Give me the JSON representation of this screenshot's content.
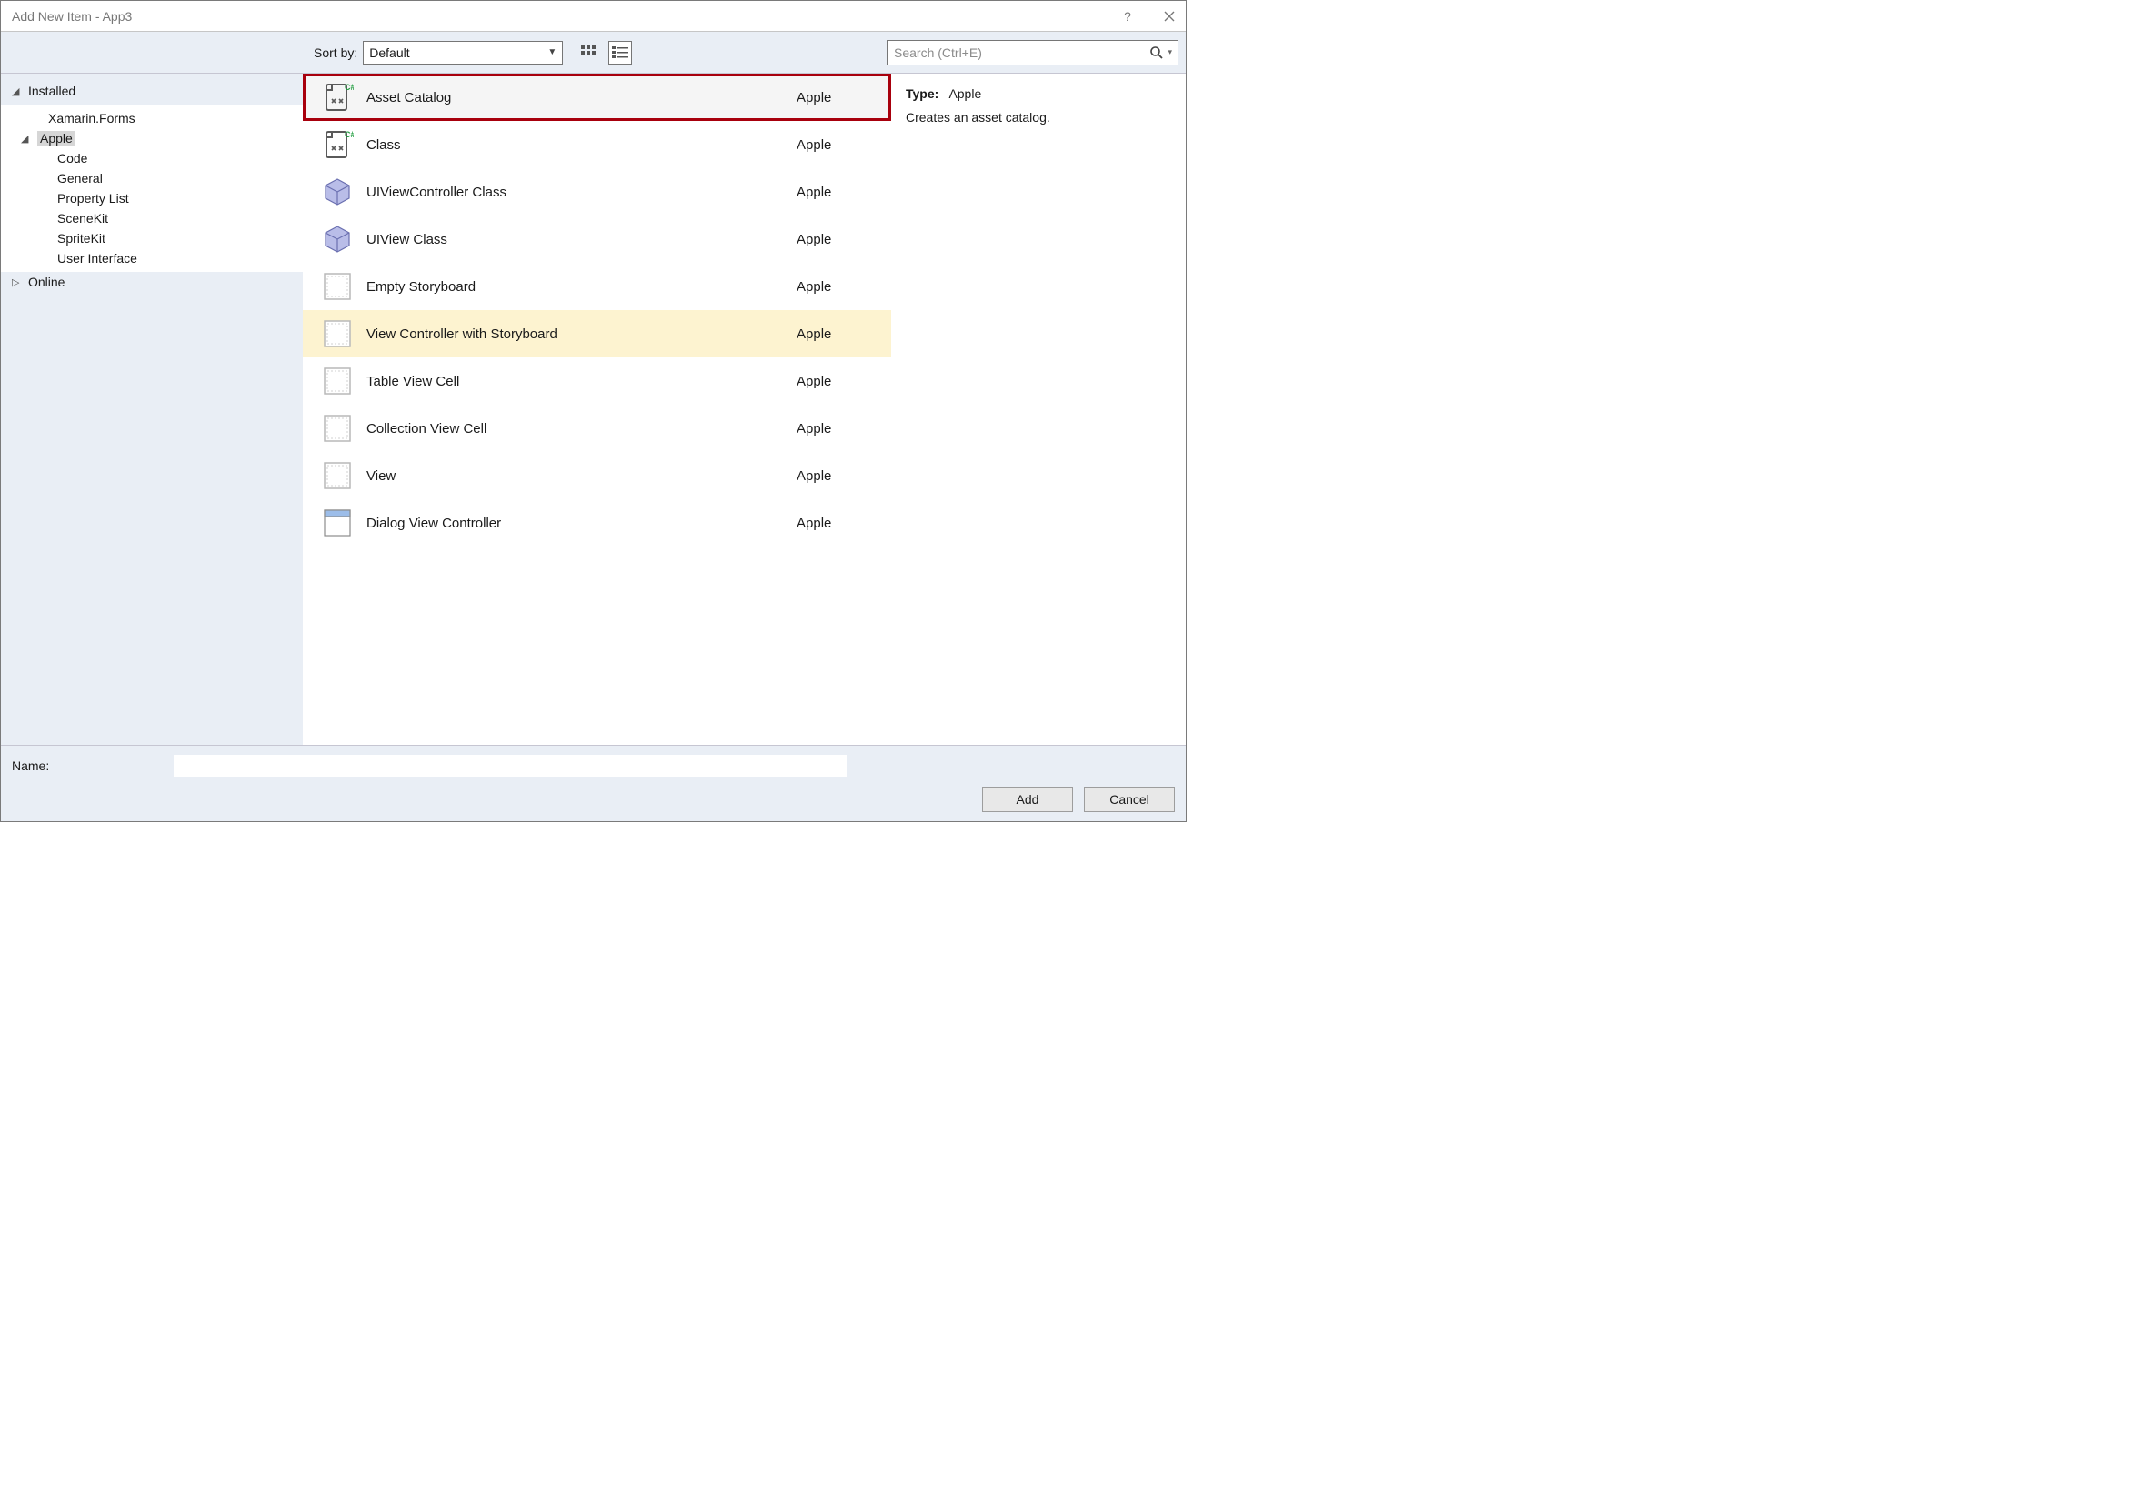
{
  "window": {
    "title": "Add New Item - App3",
    "help_tooltip": "?",
    "close_tooltip": "Close"
  },
  "toolbar": {
    "sort_label": "Sort by:",
    "sort_value": "Default",
    "search_placeholder": "Search (Ctrl+E)"
  },
  "sidebar": {
    "installed_label": "Installed",
    "online_label": "Online",
    "items": [
      {
        "label": "Xamarin.Forms"
      },
      {
        "label": "Apple",
        "selected": true,
        "children": [
          {
            "label": "Code"
          },
          {
            "label": "General"
          },
          {
            "label": "Property List"
          },
          {
            "label": "SceneKit"
          },
          {
            "label": "SpriteKit"
          },
          {
            "label": "User Interface"
          }
        ]
      }
    ]
  },
  "templates": [
    {
      "name": "Asset Catalog",
      "category": "Apple",
      "icon": "csharp",
      "state": "selected"
    },
    {
      "name": "Class",
      "category": "Apple",
      "icon": "csharp"
    },
    {
      "name": "UIViewController Class",
      "category": "Apple",
      "icon": "box3d"
    },
    {
      "name": "UIView Class",
      "category": "Apple",
      "icon": "box3d"
    },
    {
      "name": "Empty Storyboard",
      "category": "Apple",
      "icon": "storyboard"
    },
    {
      "name": "View Controller with Storyboard",
      "category": "Apple",
      "icon": "storyboard",
      "state": "hover"
    },
    {
      "name": "Table View Cell",
      "category": "Apple",
      "icon": "storyboard"
    },
    {
      "name": "Collection View Cell",
      "category": "Apple",
      "icon": "storyboard"
    },
    {
      "name": "View",
      "category": "Apple",
      "icon": "storyboard"
    },
    {
      "name": "Dialog View Controller",
      "category": "Apple",
      "icon": "dialog"
    }
  ],
  "details": {
    "type_label": "Type:",
    "type_value": "Apple",
    "description": "Creates an asset catalog."
  },
  "footer": {
    "name_label": "Name:",
    "name_value": "",
    "add_label": "Add",
    "cancel_label": "Cancel"
  }
}
